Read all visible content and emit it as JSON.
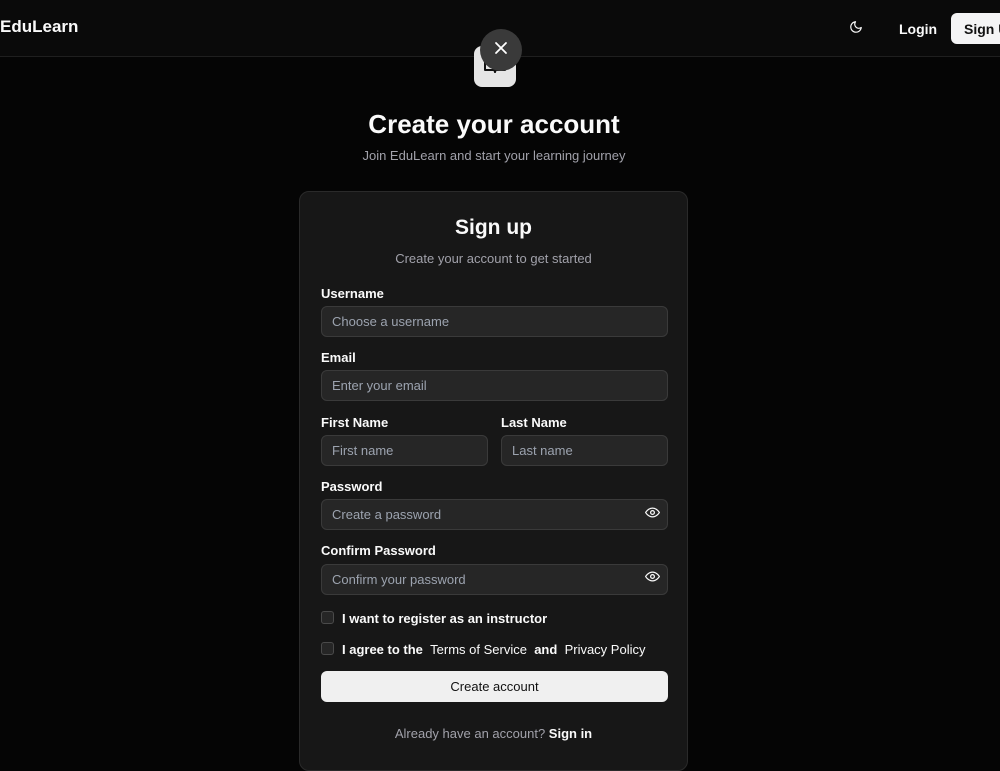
{
  "header": {
    "brand": "EduLearn",
    "login_label": "Login",
    "signup_label": "Sign Up"
  },
  "icons": {
    "theme": "moon-icon",
    "close": "close-icon",
    "logo": "book-open-icon",
    "password_toggle": "eye-icon"
  },
  "hero": {
    "title": "Create your account",
    "subtitle": "Join EduLearn and start your learning journey"
  },
  "card": {
    "title": "Sign up",
    "subtitle": "Create your account to get started"
  },
  "form": {
    "username": {
      "label": "Username",
      "placeholder": "Choose a username",
      "value": ""
    },
    "email": {
      "label": "Email",
      "placeholder": "Enter your email",
      "value": ""
    },
    "first_name": {
      "label": "First Name",
      "placeholder": "First name",
      "value": ""
    },
    "last_name": {
      "label": "Last Name",
      "placeholder": "Last name",
      "value": ""
    },
    "password": {
      "label": "Password",
      "placeholder": "Create a password",
      "value": ""
    },
    "confirm_password": {
      "label": "Confirm Password",
      "placeholder": "Confirm your password",
      "value": ""
    },
    "instructor_checkbox": {
      "label": "I want to register as an instructor",
      "checked": false
    },
    "terms_checkbox": {
      "prefix": "I agree to the",
      "terms_link": "Terms of Service",
      "conjunction": "and",
      "privacy_link": "Privacy Policy",
      "checked": false
    },
    "submit_label": "Create account"
  },
  "footer": {
    "prompt": "Already have an account?",
    "signin_label": "Sign in"
  },
  "colors": {
    "background": "#050505",
    "card": "#171717",
    "input": "#262626",
    "primary_button": "#f0f0f0",
    "muted_text": "#a1a1aa"
  }
}
